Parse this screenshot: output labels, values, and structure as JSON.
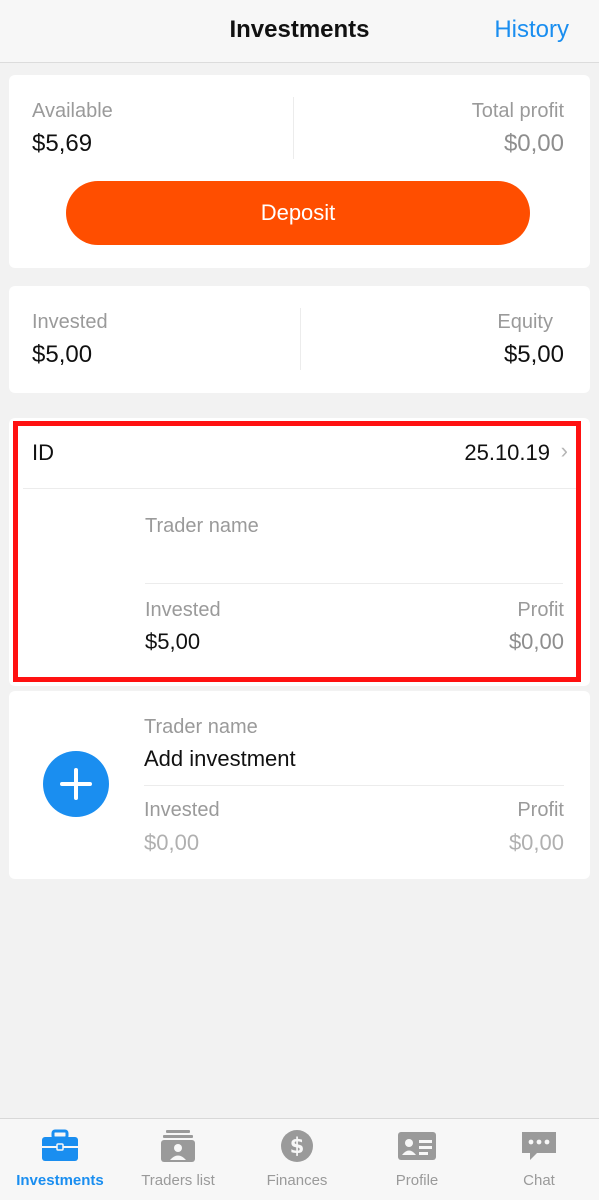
{
  "header": {
    "title": "Investments",
    "history_label": "History"
  },
  "balance_card": {
    "available_label": "Available",
    "available_value": "$5,69",
    "total_profit_label": "Total profit",
    "total_profit_value": "$0,00",
    "deposit_label": "Deposit"
  },
  "equity_card": {
    "invested_label": "Invested",
    "invested_value": "$5,00",
    "equity_label": "Equity",
    "equity_value": "$5,00"
  },
  "investment_card": {
    "id_label": "ID",
    "date": "25.10.19",
    "trader_name_label": "Trader name",
    "invested_label": "Invested",
    "invested_value": "$5,00",
    "profit_label": "Profit",
    "profit_value": "$0,00"
  },
  "add_investment_card": {
    "trader_name_label": "Trader name",
    "title": "Add investment",
    "invested_label": "Invested",
    "invested_value": "$0,00",
    "profit_label": "Profit",
    "profit_value": "$0,00"
  },
  "tabbar": {
    "items": [
      {
        "label": "Investments",
        "icon": "briefcase-icon",
        "active": true
      },
      {
        "label": "Traders list",
        "icon": "traders-list-icon",
        "active": false
      },
      {
        "label": "Finances",
        "icon": "dollar-icon",
        "active": false
      },
      {
        "label": "Profile",
        "icon": "id-card-icon",
        "active": false
      },
      {
        "label": "Chat",
        "icon": "chat-icon",
        "active": false
      }
    ]
  },
  "colors": {
    "accent": "#1a8ef0",
    "deposit": "#ff4e00",
    "highlight": "#ff1111",
    "background": "#f2f2f2"
  }
}
